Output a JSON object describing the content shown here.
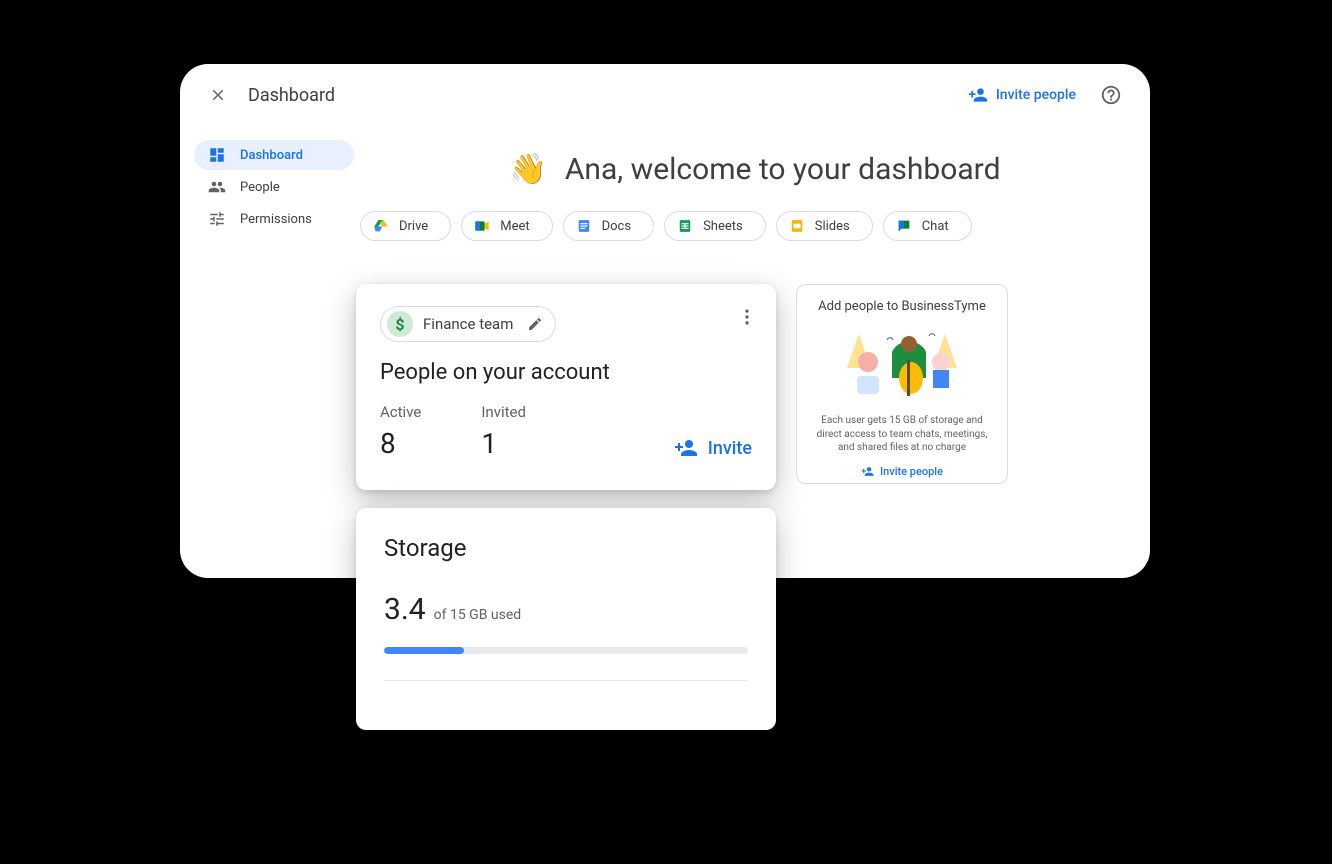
{
  "header": {
    "title": "Dashboard",
    "invite_label": "Invite people"
  },
  "sidebar": {
    "items": [
      {
        "label": "Dashboard"
      },
      {
        "label": "People"
      },
      {
        "label": "Permissions"
      }
    ]
  },
  "welcome": {
    "emoji": "👋",
    "text": "Ana, welcome to your dashboard"
  },
  "apps": [
    {
      "label": "Drive"
    },
    {
      "label": "Meet"
    },
    {
      "label": "Docs"
    },
    {
      "label": "Sheets"
    },
    {
      "label": "Slides"
    },
    {
      "label": "Chat"
    }
  ],
  "people_card": {
    "team_name": "Finance team",
    "title": "People on your account",
    "active_label": "Active",
    "active_count": "8",
    "invited_label": "Invited",
    "invited_count": "1",
    "invite_label": "Invite"
  },
  "storage_card": {
    "title": "Storage",
    "value": "3.4",
    "suffix": "of 15 GB used",
    "percent": 22
  },
  "promo_card": {
    "title": "Add people to BusinessTyme",
    "description": "Each user gets 15 GB of storage and direct access to team chats, meetings, and shared files at no charge",
    "link_label": "Invite people"
  }
}
